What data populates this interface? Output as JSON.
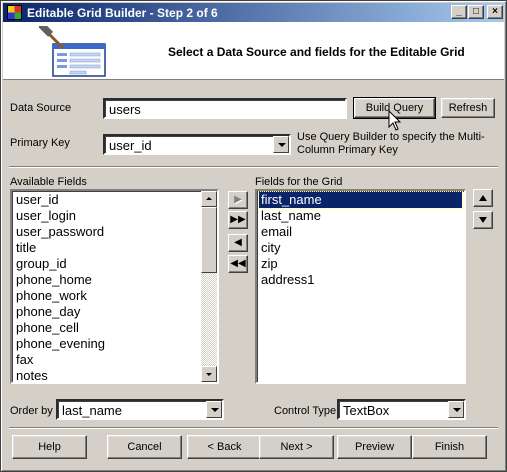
{
  "window": {
    "title": "Editable Grid Builder - Step 2 of 6",
    "controls": {
      "minimize": "_",
      "maximize": "□",
      "close": "×"
    }
  },
  "header": {
    "text": "Select a Data Source and fields for the Editable Grid",
    "graphic_icon": "wizard-hammer-form-icon"
  },
  "data_source": {
    "label": "Data Source",
    "value": "users",
    "build_query_label": "Build Query",
    "refresh_label": "Refresh"
  },
  "primary_key": {
    "label": "Primary Key",
    "value": "user_id",
    "hint": "Use Query Builder to specify the Multi-Column Primary Key"
  },
  "available_fields": {
    "label": "Available Fields",
    "items": [
      "user_id",
      "user_login",
      "user_password",
      "title",
      "group_id",
      "phone_home",
      "phone_work",
      "phone_day",
      "phone_cell",
      "phone_evening",
      "fax",
      "notes"
    ]
  },
  "grid_fields": {
    "label": "Fields for the Grid",
    "items": [
      "first_name",
      "last_name",
      "email",
      "city",
      "zip",
      "address1"
    ],
    "selected_index": 0
  },
  "move_buttons": {
    "add_one": "▶",
    "add_all": "▶▶",
    "remove_one": "◀",
    "remove_all": "◀◀"
  },
  "order_by": {
    "label": "Order by",
    "value": "last_name"
  },
  "control_type": {
    "label": "Control Type",
    "value": "TextBox"
  },
  "footer": {
    "help": "Help",
    "cancel": "Cancel",
    "back": "< Back",
    "next": "Next >",
    "preview": "Preview",
    "finish": "Finish"
  }
}
